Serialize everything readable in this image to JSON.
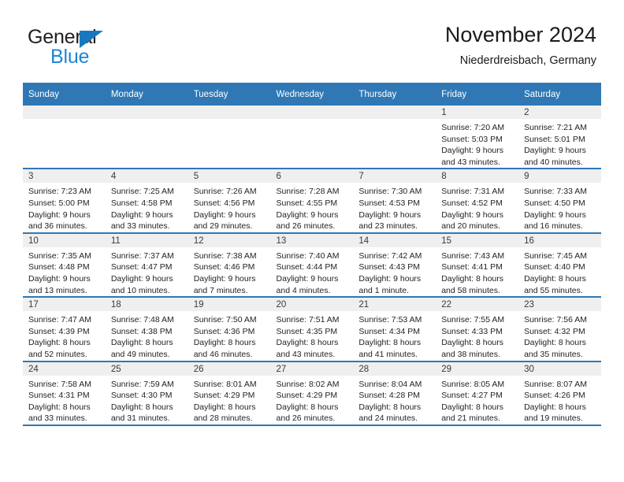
{
  "brand": {
    "word1": "General",
    "word2": "Blue",
    "colors": {
      "dark": "#231f20",
      "blue": "#1c86d4",
      "triangle": "#1878be"
    }
  },
  "header": {
    "title": "November 2024",
    "location": "Niederdreisbach, Germany",
    "accent_color": "#2f78b5"
  },
  "weekdays": [
    "Sunday",
    "Monday",
    "Tuesday",
    "Wednesday",
    "Thursday",
    "Friday",
    "Saturday"
  ],
  "weeks": [
    [
      {
        "day": "",
        "empty": true
      },
      {
        "day": "",
        "empty": true
      },
      {
        "day": "",
        "empty": true
      },
      {
        "day": "",
        "empty": true
      },
      {
        "day": "",
        "empty": true
      },
      {
        "day": "1",
        "sunrise": "Sunrise: 7:20 AM",
        "sunset": "Sunset: 5:03 PM",
        "daylight1": "Daylight: 9 hours",
        "daylight2": "and 43 minutes."
      },
      {
        "day": "2",
        "sunrise": "Sunrise: 7:21 AM",
        "sunset": "Sunset: 5:01 PM",
        "daylight1": "Daylight: 9 hours",
        "daylight2": "and 40 minutes."
      }
    ],
    [
      {
        "day": "3",
        "sunrise": "Sunrise: 7:23 AM",
        "sunset": "Sunset: 5:00 PM",
        "daylight1": "Daylight: 9 hours",
        "daylight2": "and 36 minutes."
      },
      {
        "day": "4",
        "sunrise": "Sunrise: 7:25 AM",
        "sunset": "Sunset: 4:58 PM",
        "daylight1": "Daylight: 9 hours",
        "daylight2": "and 33 minutes."
      },
      {
        "day": "5",
        "sunrise": "Sunrise: 7:26 AM",
        "sunset": "Sunset: 4:56 PM",
        "daylight1": "Daylight: 9 hours",
        "daylight2": "and 29 minutes."
      },
      {
        "day": "6",
        "sunrise": "Sunrise: 7:28 AM",
        "sunset": "Sunset: 4:55 PM",
        "daylight1": "Daylight: 9 hours",
        "daylight2": "and 26 minutes."
      },
      {
        "day": "7",
        "sunrise": "Sunrise: 7:30 AM",
        "sunset": "Sunset: 4:53 PM",
        "daylight1": "Daylight: 9 hours",
        "daylight2": "and 23 minutes."
      },
      {
        "day": "8",
        "sunrise": "Sunrise: 7:31 AM",
        "sunset": "Sunset: 4:52 PM",
        "daylight1": "Daylight: 9 hours",
        "daylight2": "and 20 minutes."
      },
      {
        "day": "9",
        "sunrise": "Sunrise: 7:33 AM",
        "sunset": "Sunset: 4:50 PM",
        "daylight1": "Daylight: 9 hours",
        "daylight2": "and 16 minutes."
      }
    ],
    [
      {
        "day": "10",
        "sunrise": "Sunrise: 7:35 AM",
        "sunset": "Sunset: 4:48 PM",
        "daylight1": "Daylight: 9 hours",
        "daylight2": "and 13 minutes."
      },
      {
        "day": "11",
        "sunrise": "Sunrise: 7:37 AM",
        "sunset": "Sunset: 4:47 PM",
        "daylight1": "Daylight: 9 hours",
        "daylight2": "and 10 minutes."
      },
      {
        "day": "12",
        "sunrise": "Sunrise: 7:38 AM",
        "sunset": "Sunset: 4:46 PM",
        "daylight1": "Daylight: 9 hours",
        "daylight2": "and 7 minutes."
      },
      {
        "day": "13",
        "sunrise": "Sunrise: 7:40 AM",
        "sunset": "Sunset: 4:44 PM",
        "daylight1": "Daylight: 9 hours",
        "daylight2": "and 4 minutes."
      },
      {
        "day": "14",
        "sunrise": "Sunrise: 7:42 AM",
        "sunset": "Sunset: 4:43 PM",
        "daylight1": "Daylight: 9 hours",
        "daylight2": "and 1 minute."
      },
      {
        "day": "15",
        "sunrise": "Sunrise: 7:43 AM",
        "sunset": "Sunset: 4:41 PM",
        "daylight1": "Daylight: 8 hours",
        "daylight2": "and 58 minutes."
      },
      {
        "day": "16",
        "sunrise": "Sunrise: 7:45 AM",
        "sunset": "Sunset: 4:40 PM",
        "daylight1": "Daylight: 8 hours",
        "daylight2": "and 55 minutes."
      }
    ],
    [
      {
        "day": "17",
        "sunrise": "Sunrise: 7:47 AM",
        "sunset": "Sunset: 4:39 PM",
        "daylight1": "Daylight: 8 hours",
        "daylight2": "and 52 minutes."
      },
      {
        "day": "18",
        "sunrise": "Sunrise: 7:48 AM",
        "sunset": "Sunset: 4:38 PM",
        "daylight1": "Daylight: 8 hours",
        "daylight2": "and 49 minutes."
      },
      {
        "day": "19",
        "sunrise": "Sunrise: 7:50 AM",
        "sunset": "Sunset: 4:36 PM",
        "daylight1": "Daylight: 8 hours",
        "daylight2": "and 46 minutes."
      },
      {
        "day": "20",
        "sunrise": "Sunrise: 7:51 AM",
        "sunset": "Sunset: 4:35 PM",
        "daylight1": "Daylight: 8 hours",
        "daylight2": "and 43 minutes."
      },
      {
        "day": "21",
        "sunrise": "Sunrise: 7:53 AM",
        "sunset": "Sunset: 4:34 PM",
        "daylight1": "Daylight: 8 hours",
        "daylight2": "and 41 minutes."
      },
      {
        "day": "22",
        "sunrise": "Sunrise: 7:55 AM",
        "sunset": "Sunset: 4:33 PM",
        "daylight1": "Daylight: 8 hours",
        "daylight2": "and 38 minutes."
      },
      {
        "day": "23",
        "sunrise": "Sunrise: 7:56 AM",
        "sunset": "Sunset: 4:32 PM",
        "daylight1": "Daylight: 8 hours",
        "daylight2": "and 35 minutes."
      }
    ],
    [
      {
        "day": "24",
        "sunrise": "Sunrise: 7:58 AM",
        "sunset": "Sunset: 4:31 PM",
        "daylight1": "Daylight: 8 hours",
        "daylight2": "and 33 minutes."
      },
      {
        "day": "25",
        "sunrise": "Sunrise: 7:59 AM",
        "sunset": "Sunset: 4:30 PM",
        "daylight1": "Daylight: 8 hours",
        "daylight2": "and 31 minutes."
      },
      {
        "day": "26",
        "sunrise": "Sunrise: 8:01 AM",
        "sunset": "Sunset: 4:29 PM",
        "daylight1": "Daylight: 8 hours",
        "daylight2": "and 28 minutes."
      },
      {
        "day": "27",
        "sunrise": "Sunrise: 8:02 AM",
        "sunset": "Sunset: 4:29 PM",
        "daylight1": "Daylight: 8 hours",
        "daylight2": "and 26 minutes."
      },
      {
        "day": "28",
        "sunrise": "Sunrise: 8:04 AM",
        "sunset": "Sunset: 4:28 PM",
        "daylight1": "Daylight: 8 hours",
        "daylight2": "and 24 minutes."
      },
      {
        "day": "29",
        "sunrise": "Sunrise: 8:05 AM",
        "sunset": "Sunset: 4:27 PM",
        "daylight1": "Daylight: 8 hours",
        "daylight2": "and 21 minutes."
      },
      {
        "day": "30",
        "sunrise": "Sunrise: 8:07 AM",
        "sunset": "Sunset: 4:26 PM",
        "daylight1": "Daylight: 8 hours",
        "daylight2": "and 19 minutes."
      }
    ]
  ]
}
